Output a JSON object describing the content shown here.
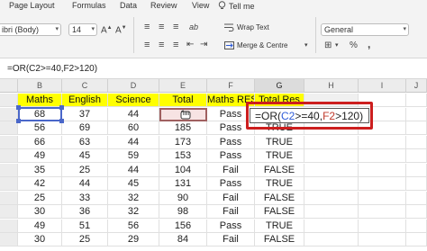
{
  "menu": {
    "items": [
      "Page Layout",
      "Formulas",
      "Data",
      "Review",
      "View",
      "Tell me"
    ]
  },
  "ribbon": {
    "font_name": "ibri (Body)",
    "font_size": "14",
    "align_glyph_1": "≡",
    "align_glyph_2": "≡",
    "align_glyph_3": "≡",
    "indent_glyph_1": "⇤",
    "indent_glyph_2": "⇥",
    "orient_glyph": "ab",
    "wrap_text": "Wrap Text",
    "merge_centre": "Merge & Centre",
    "number_format": "General",
    "currency_glyph": "⊞",
    "percent_glyph": "%",
    "comma_glyph": ","
  },
  "formula_bar": {
    "text": "=OR(C2>=40,F2>120)"
  },
  "columns": [
    "B",
    "C",
    "D",
    "E",
    "F",
    "G",
    "H",
    "I",
    "J"
  ],
  "sheet": {
    "headers": [
      "Maths",
      "English",
      "Science",
      "Total",
      "Maths RES",
      "Total Res"
    ],
    "rows": [
      [
        "68",
        "37",
        "44",
        "1",
        "Pass",
        ""
      ],
      [
        "56",
        "69",
        "60",
        "185",
        "Pass",
        "TRUE"
      ],
      [
        "66",
        "63",
        "44",
        "173",
        "Pass",
        "TRUE"
      ],
      [
        "49",
        "45",
        "59",
        "153",
        "Pass",
        "TRUE"
      ],
      [
        "35",
        "25",
        "44",
        "104",
        "Fail",
        "FALSE"
      ],
      [
        "42",
        "44",
        "45",
        "131",
        "Pass",
        "TRUE"
      ],
      [
        "25",
        "33",
        "32",
        "90",
        "Fail",
        "FALSE"
      ],
      [
        "30",
        "36",
        "32",
        "98",
        "Fail",
        "FALSE"
      ],
      [
        "49",
        "51",
        "56",
        "156",
        "Pass",
        "TRUE"
      ],
      [
        "30",
        "25",
        "29",
        "84",
        "Fail",
        "FALSE"
      ]
    ]
  },
  "editing": {
    "prefix": "=OR(",
    "ref1": "C2",
    "middle": ">=40,",
    "ref2": "F2",
    "suffix": ">120)"
  },
  "colors": {
    "header_fill": "#ffff00",
    "highlight_box": "#cc1e1e",
    "ref1_color": "#2e5bd8",
    "ref2_color": "#c0392b"
  }
}
